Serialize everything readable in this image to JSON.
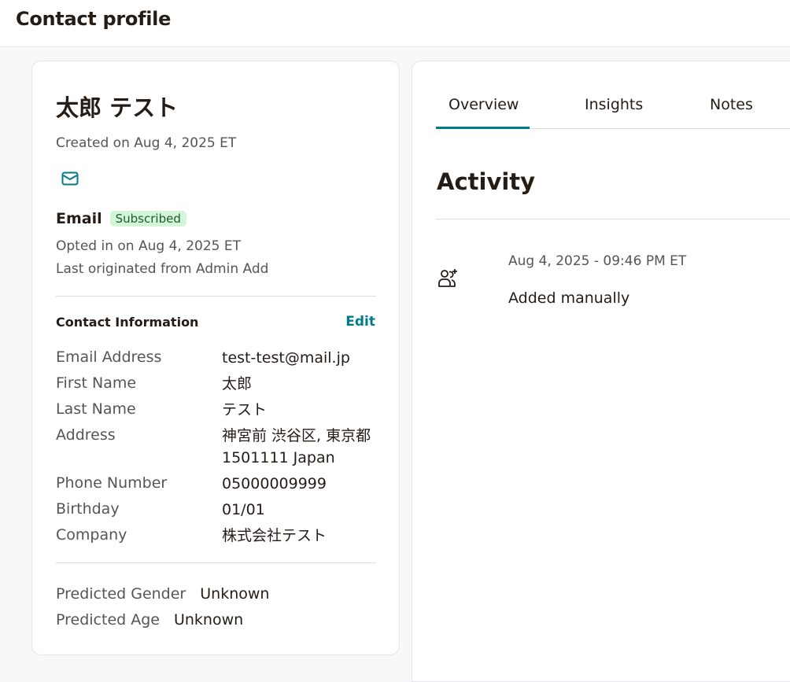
{
  "header": {
    "title": "Contact profile"
  },
  "contact": {
    "name": "太郎 テスト",
    "created": "Created on Aug 4, 2025 ET",
    "email_channel": {
      "label": "Email",
      "status": "Subscribed",
      "opted_in": "Opted in on Aug 4, 2025 ET",
      "originated": "Last originated from Admin Add"
    }
  },
  "contact_info": {
    "title": "Contact Information",
    "edit_label": "Edit",
    "fields": [
      {
        "label": "Email Address",
        "value": "test-test@mail.jp"
      },
      {
        "label": "First Name",
        "value": "太郎"
      },
      {
        "label": "Last Name",
        "value": "テスト"
      },
      {
        "label": "Address",
        "value": "神宮前 渋谷区, 東京都 1501111 Japan"
      },
      {
        "label": "Phone Number",
        "value": "05000009999"
      },
      {
        "label": "Birthday",
        "value": "01/01"
      },
      {
        "label": "Company",
        "value": "株式会社テスト"
      }
    ]
  },
  "predictions": [
    {
      "label": "Predicted Gender",
      "value": "Unknown"
    },
    {
      "label": "Predicted Age",
      "value": "Unknown"
    }
  ],
  "tabs": [
    {
      "label": "Overview",
      "active": true
    },
    {
      "label": "Insights",
      "active": false
    },
    {
      "label": "Notes",
      "active": false
    }
  ],
  "activity": {
    "title": "Activity",
    "items": [
      {
        "icon": "user-add-icon",
        "time": "Aug 4, 2025 - 09:46 PM ET",
        "description": "Added manually"
      }
    ]
  },
  "icons": {
    "email_channel": "mail-icon"
  },
  "colors": {
    "accent": "#007c89",
    "badge_bg": "#d4f5d8",
    "badge_text": "#1f5b2c",
    "text": "#241c15"
  }
}
